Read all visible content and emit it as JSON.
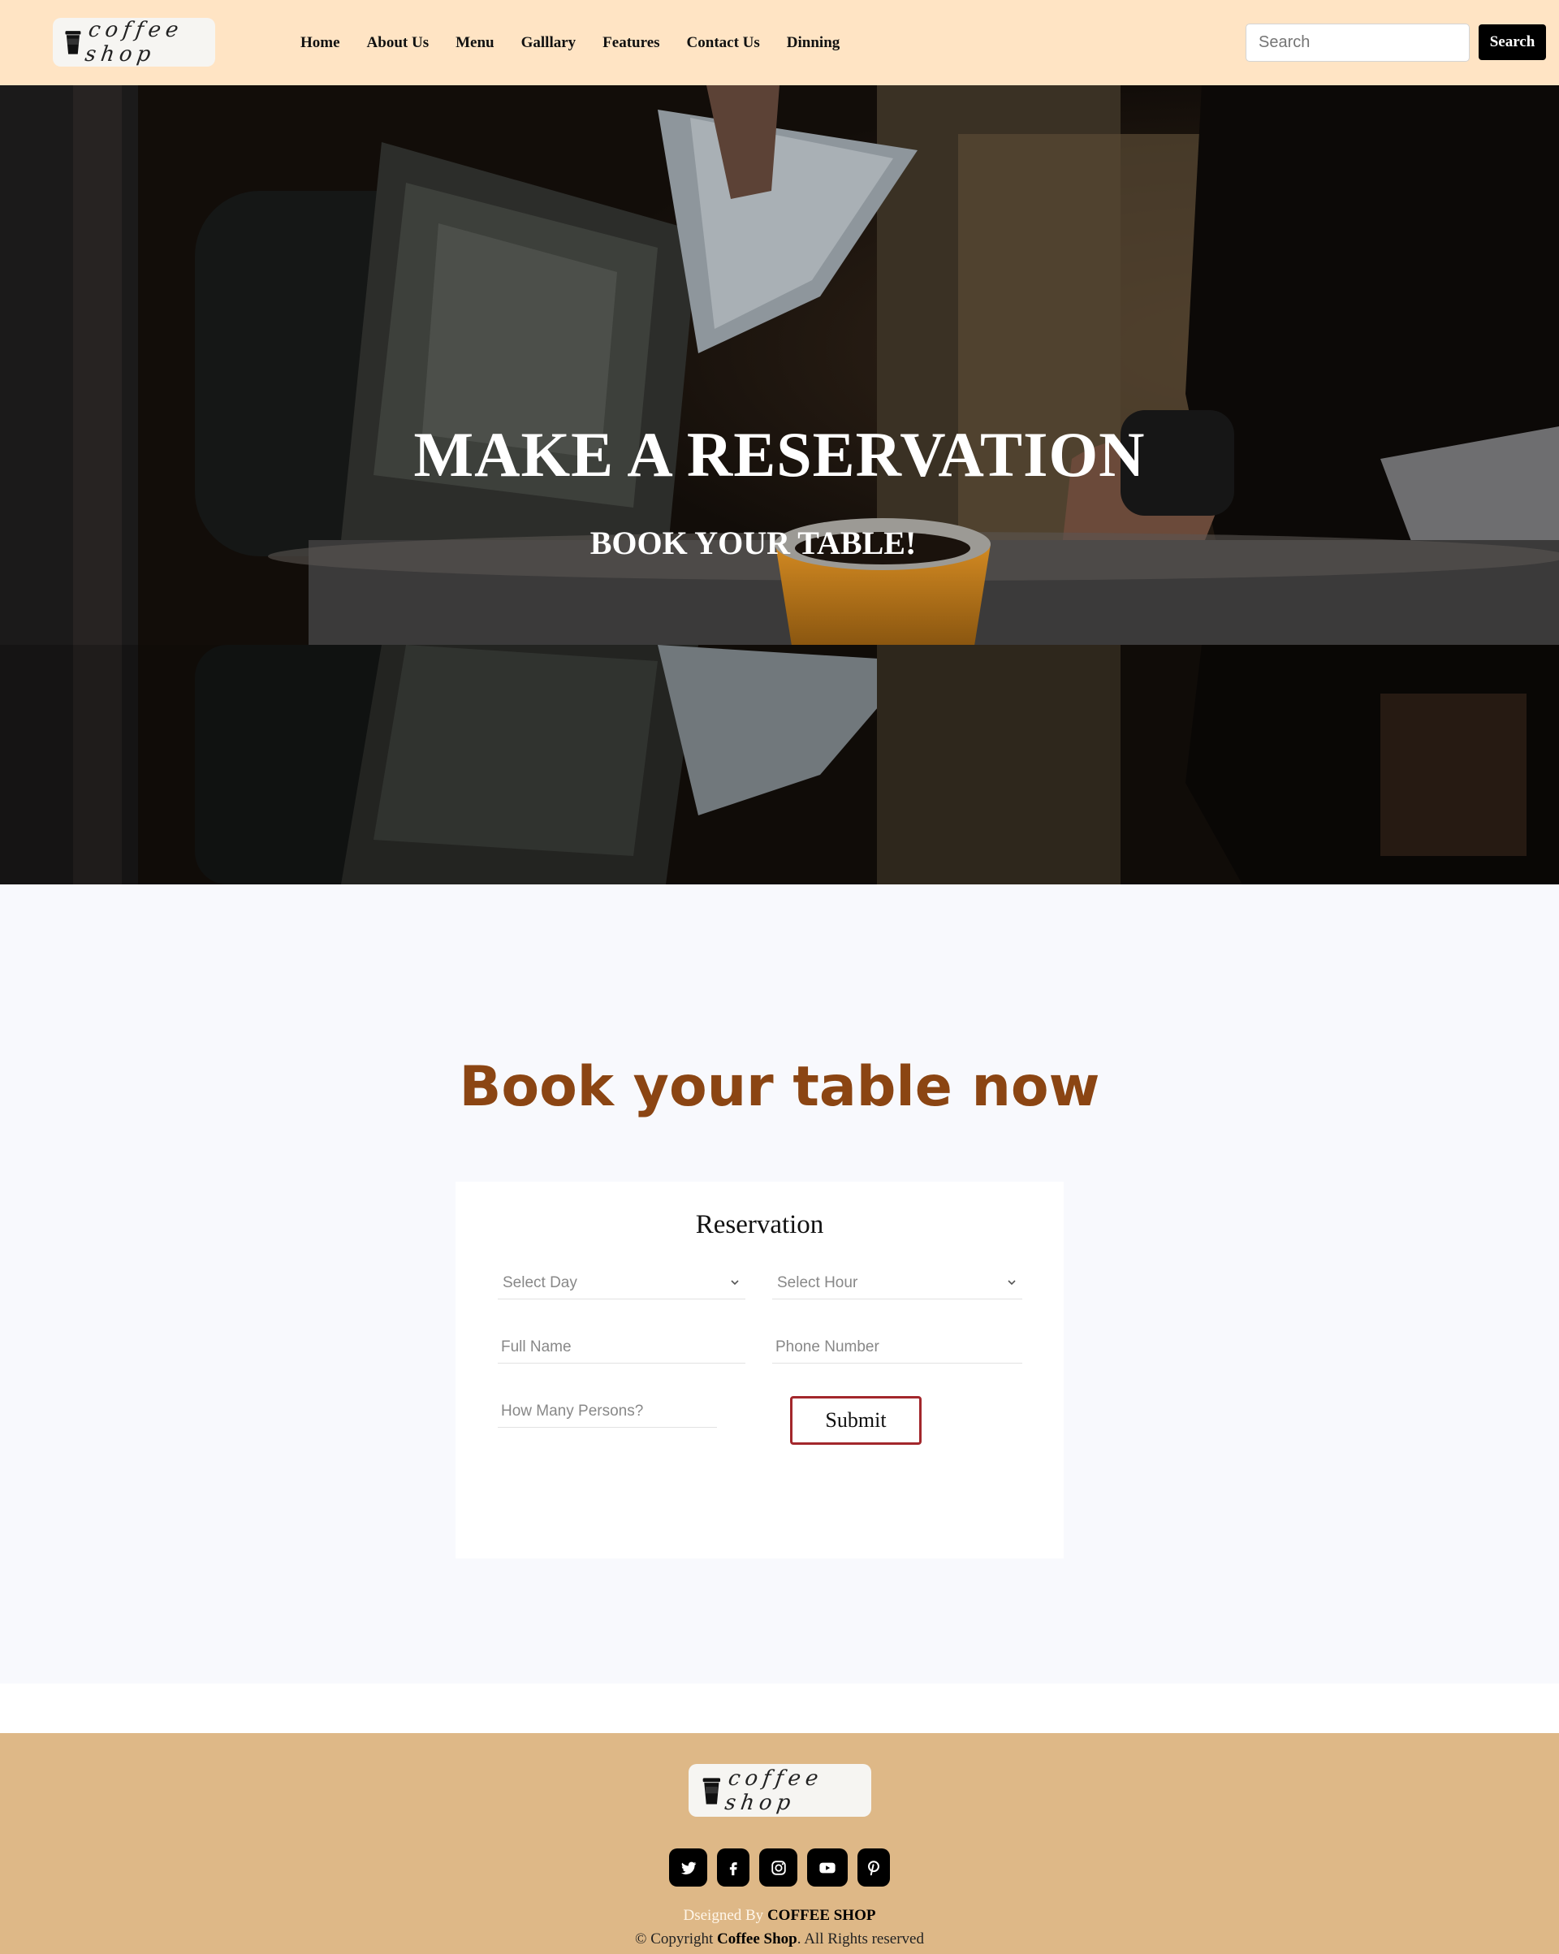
{
  "brand": {
    "logo_text": "coffee shop"
  },
  "nav": {
    "links": [
      "Home",
      "About Us",
      "Menu",
      "Galllary",
      "Features",
      "Contact Us",
      "Dinning"
    ],
    "search_placeholder": "Search",
    "search_button": "Search"
  },
  "hero": {
    "title": "MAKE A RESERVATION",
    "subtitle": "BOOK YOUR TABLE!"
  },
  "booking": {
    "heading": "Book your table now",
    "card_title": "Reservation",
    "select_day": "Select Day",
    "select_hour": "Select Hour",
    "full_name_placeholder": "Full Name",
    "phone_placeholder": "Phone Number",
    "persons_placeholder": "How Many Persons?",
    "submit_label": "Submit"
  },
  "footer": {
    "logo_text": "coffee shop",
    "social": [
      "twitter-icon",
      "facebook-icon",
      "instagram-icon",
      "youtube-icon",
      "pinterest-icon"
    ],
    "credit_prefix": "Dseigned By",
    "credit_brand": "COFFEE SHOP",
    "copyright_prefix": "© Copyright",
    "copyright_brand": "Coffee Shop",
    "copyright_suffix": ". All Rights reserved"
  },
  "colors": {
    "navbar_bg": "#ffe4c4",
    "heading_brown": "#8b4513",
    "submit_border": "#a3272c",
    "footer_bg": "#deb887",
    "section_bg": "#f8f9fd"
  }
}
